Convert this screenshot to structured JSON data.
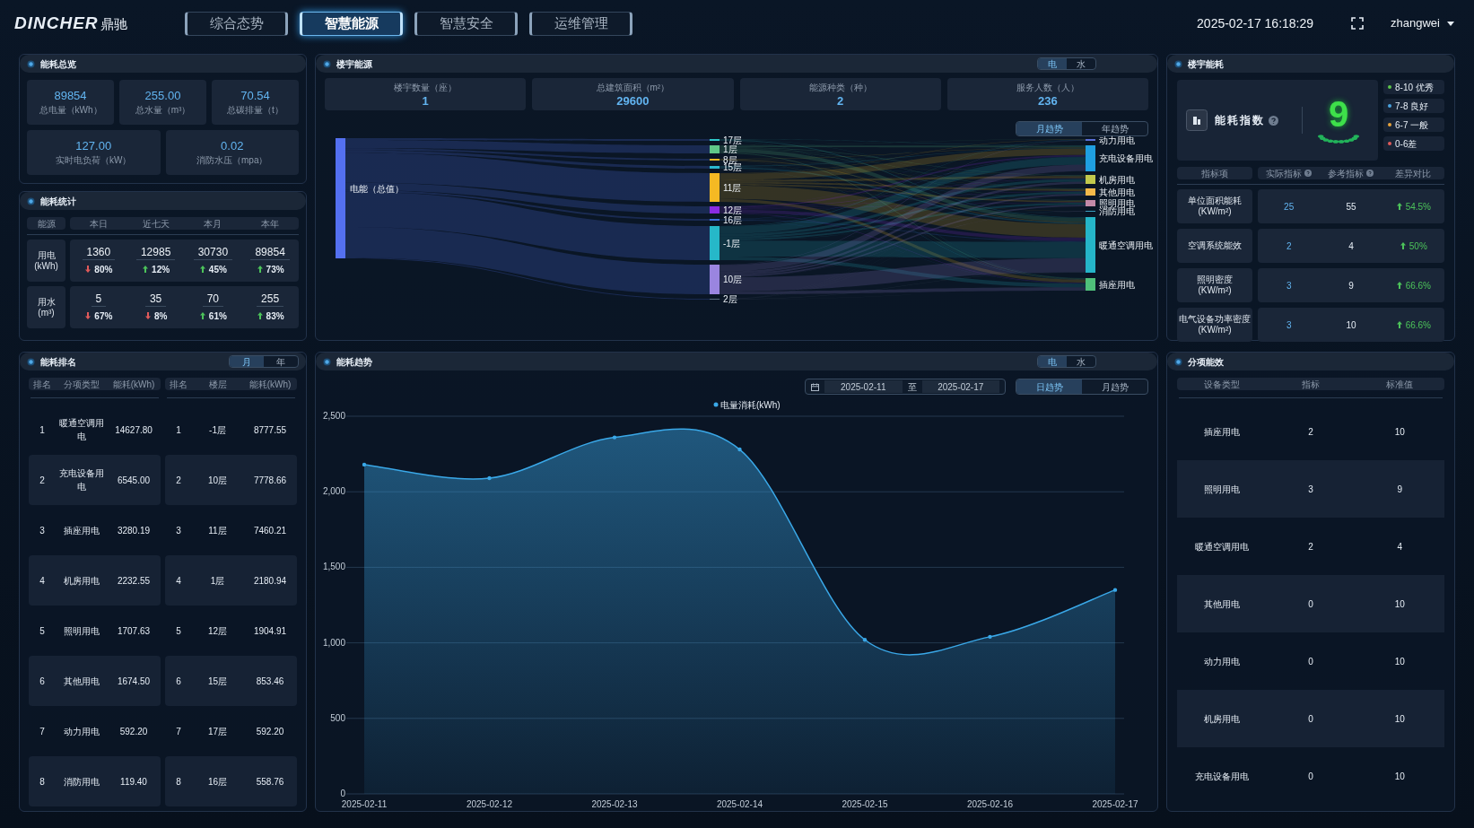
{
  "header": {
    "logo": "DINCHER",
    "logo_cn": "鼎驰",
    "nav": [
      {
        "label": "综合态势",
        "selected": false
      },
      {
        "label": "智慧能源",
        "selected": true
      },
      {
        "label": "智慧安全",
        "selected": false
      },
      {
        "label": "运维管理",
        "selected": false
      }
    ],
    "datetime": "2025-02-17 16:18:29",
    "user": "zhangwei"
  },
  "overview": {
    "title": "能耗总览",
    "cards": [
      {
        "value": "89854",
        "label": "总电量（kWh）"
      },
      {
        "value": "255.00",
        "label": "总水量（m³）"
      },
      {
        "value": "70.54",
        "label": "总碳排量（t）"
      },
      {
        "value": "127.00",
        "label": "实时电负荷（kW）"
      },
      {
        "value": "0.02",
        "label": "消防水压（mpa）"
      }
    ]
  },
  "stats": {
    "title": "能耗统计",
    "label_header": "能源",
    "period_headers": [
      "本日",
      "近七天",
      "本月",
      "本年"
    ],
    "rows": [
      {
        "label": "用电",
        "unit": "(kWh)",
        "cells": [
          {
            "value": "1360",
            "change": "80%",
            "increase": false
          },
          {
            "value": "12985",
            "change": "12%",
            "increase": true
          },
          {
            "value": "30730",
            "change": "45%",
            "increase": true
          },
          {
            "value": "89854",
            "change": "73%",
            "increase": true
          }
        ]
      },
      {
        "label": "用水",
        "unit": "(m³)",
        "cells": [
          {
            "value": "5",
            "change": "67%",
            "increase": false
          },
          {
            "value": "35",
            "change": "8%",
            "increase": false
          },
          {
            "value": "70",
            "change": "61%",
            "increase": true
          },
          {
            "value": "255",
            "change": "83%",
            "increase": true
          }
        ]
      }
    ]
  },
  "ranking": {
    "title": "能耗排名",
    "toggle": [
      {
        "label": "月",
        "selected": true
      },
      {
        "label": "年",
        "selected": false
      }
    ],
    "by_type": {
      "columns": [
        "排名",
        "分项类型",
        "能耗(kWh)"
      ],
      "rows": [
        [
          "1",
          "暖通空调用电",
          "14627.80"
        ],
        [
          "2",
          "充电设备用电",
          "6545.00"
        ],
        [
          "3",
          "插座用电",
          "3280.19"
        ],
        [
          "4",
          "机房用电",
          "2232.55"
        ],
        [
          "5",
          "照明用电",
          "1707.63"
        ],
        [
          "6",
          "其他用电",
          "1674.50"
        ],
        [
          "7",
          "动力用电",
          "592.20"
        ],
        [
          "8",
          "消防用电",
          "119.40"
        ]
      ]
    },
    "by_floor": {
      "columns": [
        "排名",
        "楼层",
        "能耗(kWh)"
      ],
      "rows": [
        [
          "1",
          "-1层",
          "8777.55"
        ],
        [
          "2",
          "10层",
          "7778.66"
        ],
        [
          "3",
          "11层",
          "7460.21"
        ],
        [
          "4",
          "1层",
          "2180.94"
        ],
        [
          "5",
          "12层",
          "1904.91"
        ],
        [
          "6",
          "15层",
          "853.46"
        ],
        [
          "7",
          "17层",
          "592.20"
        ],
        [
          "8",
          "16层",
          "558.76"
        ]
      ]
    }
  },
  "building_energy": {
    "title": "楼宇能源",
    "toggle": [
      {
        "label": "电",
        "selected": true
      },
      {
        "label": "水",
        "selected": false
      }
    ],
    "kpis": [
      {
        "label": "楼宇数量（座）",
        "value": "1"
      },
      {
        "label": "总建筑面积（m²）",
        "value": "29600"
      },
      {
        "label": "能源种类（种）",
        "value": "2"
      },
      {
        "label": "服务人数（人）",
        "value": "236"
      }
    ],
    "period_toggle": [
      {
        "label": "月趋势",
        "selected": true
      },
      {
        "label": "年趋势",
        "selected": false
      }
    ],
    "sankey": {
      "source": {
        "label": "电能（总值）",
        "color": "#5470f0"
      },
      "floors": [
        {
          "label": "17层",
          "color": "#2ec7c9"
        },
        {
          "label": "1层",
          "color": "#5fc888"
        },
        {
          "label": "8层",
          "color": "#e8b825"
        },
        {
          "label": "15层",
          "color": "#2bb8d0"
        },
        {
          "label": "11层",
          "color": "#f5b923"
        },
        {
          "label": "12层",
          "color": "#8a2be2"
        },
        {
          "label": "16层",
          "color": "#3b6fd8"
        },
        {
          "label": "-1层",
          "color": "#26b8c9"
        },
        {
          "label": "10层",
          "color": "#9a85e0"
        },
        {
          "label": "2层",
          "color": "#5a6c80"
        }
      ],
      "uses": [
        {
          "label": "动力用电",
          "color": "#5a6fd8"
        },
        {
          "label": "充电设备用电",
          "color": "#1f9fe0"
        },
        {
          "label": "机房用电",
          "color": "#c2c94c"
        },
        {
          "label": "其他用电",
          "color": "#f5b94a"
        },
        {
          "label": "照明用电",
          "color": "#c48aa8"
        },
        {
          "label": "消防用电",
          "color": "#3aa0c0"
        },
        {
          "label": "暖通空调用电",
          "color": "#25b5c8"
        },
        {
          "label": "插座用电",
          "color": "#4fc07a"
        }
      ]
    }
  },
  "energy_trend": {
    "title": "能耗趋势",
    "toggle": [
      {
        "label": "电",
        "selected": true
      },
      {
        "label": "水",
        "selected": false
      }
    ],
    "date_range": {
      "start": "2025-02-11",
      "separator": "至",
      "end": "2025-02-17"
    },
    "period_toggle": [
      {
        "label": "日趋势",
        "selected": true
      },
      {
        "label": "月趋势",
        "selected": false
      }
    ],
    "chart_data": {
      "type": "area",
      "grid": true,
      "categories": [
        "2025-02-11",
        "2025-02-12",
        "2025-02-13",
        "2025-02-14",
        "2025-02-15",
        "2025-02-16",
        "2025-02-17"
      ],
      "series": [
        {
          "name": "电量消耗(kWh)",
          "color": "#3aa8e8",
          "values": [
            2180,
            2090,
            2360,
            2280,
            1020,
            1040,
            1350
          ]
        }
      ],
      "ylim": [
        0,
        2500
      ],
      "yticks": [
        {
          "value": 0,
          "label": "0"
        },
        {
          "value": 500,
          "label": "500"
        },
        {
          "value": 1000,
          "label": "1,000"
        },
        {
          "value": 1500,
          "label": "1,500"
        },
        {
          "value": 2000,
          "label": "2,000"
        },
        {
          "value": 2500,
          "label": "2,500"
        }
      ]
    }
  },
  "building_consumption": {
    "title": "楼宇能耗",
    "index_label": "能耗指数",
    "score": "9",
    "grades": [
      {
        "label": "8-10 优秀",
        "color": "#5dc44a"
      },
      {
        "label": "7-8 良好",
        "color": "#4aa3df"
      },
      {
        "label": "6-7 一般",
        "color": "#e8a33c"
      },
      {
        "label": "0-6差",
        "color": "#e05a5a"
      }
    ],
    "columns": [
      {
        "label": "指标项",
        "help": false
      },
      {
        "label": "实际指标",
        "help": true
      },
      {
        "label": "参考指标",
        "help": true
      },
      {
        "label": "差异对比",
        "help": false
      }
    ],
    "rows": [
      {
        "name": "单位面积能耗",
        "unit": "(KW/m²)",
        "actual": "25",
        "reference": "55",
        "diff": "54.5%",
        "increase": true
      },
      {
        "name": "空调系统能效",
        "actual": "2",
        "reference": "4",
        "diff": "50%",
        "increase": true
      },
      {
        "name": "照明密度",
        "unit": "(KW/m²)",
        "actual": "3",
        "reference": "9",
        "diff": "66.6%",
        "increase": true
      },
      {
        "name": "电气设备功率密度",
        "unit": "(KW/m²)",
        "actual": "3",
        "reference": "10",
        "diff": "66.6%",
        "increase": true
      }
    ]
  },
  "sub_efficiency": {
    "title": "分项能效",
    "columns": [
      "设备类型",
      "指标",
      "标准值"
    ],
    "rows": [
      [
        "插座用电",
        "2",
        "10"
      ],
      [
        "照明用电",
        "3",
        "9"
      ],
      [
        "暖通空调用电",
        "2",
        "4"
      ],
      [
        "其他用电",
        "0",
        "10"
      ],
      [
        "动力用电",
        "0",
        "10"
      ],
      [
        "机房用电",
        "0",
        "10"
      ],
      [
        "充电设备用电",
        "0",
        "10"
      ]
    ]
  }
}
